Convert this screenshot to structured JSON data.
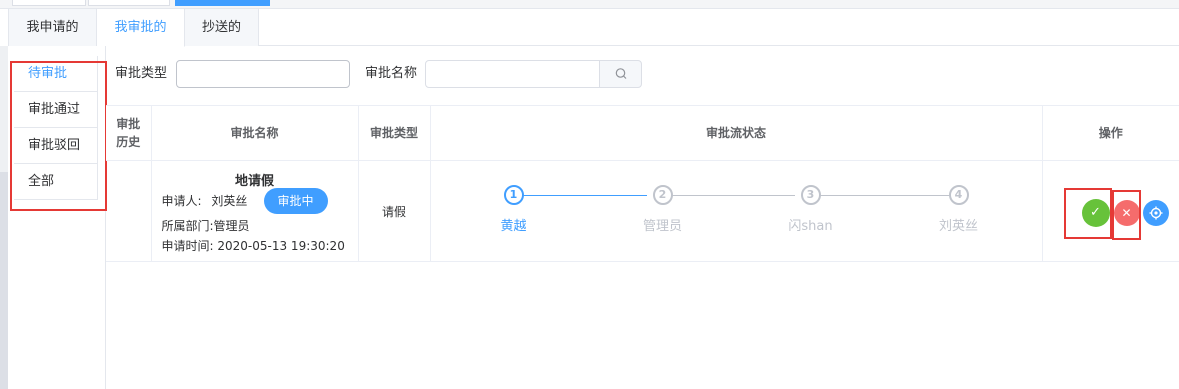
{
  "tabs": [
    {
      "label": "我申请的"
    },
    {
      "label": "我审批的"
    },
    {
      "label": "抄送的"
    }
  ],
  "side_menu": [
    {
      "label": "待审批"
    },
    {
      "label": "审批通过"
    },
    {
      "label": "审批驳回"
    },
    {
      "label": "全部"
    }
  ],
  "filters": {
    "type_label": "审批类型",
    "type_value": "",
    "name_label": "审批名称",
    "name_value": ""
  },
  "table": {
    "headers": {
      "history": "审批历史",
      "name": "审批名称",
      "type": "审批类型",
      "flow": "审批流状态",
      "ops": "操作"
    },
    "rows": [
      {
        "title": "地请假",
        "applicant_label": "申请人:",
        "applicant": "刘英丝",
        "dept_label": "所属部门:",
        "dept": "管理员",
        "time_label": "申请时间:",
        "time": "2020-05-13 19:30:20",
        "status": "审批中",
        "type": "请假",
        "steps": [
          {
            "num": "1",
            "name": "黄越"
          },
          {
            "num": "2",
            "name": "管理员"
          },
          {
            "num": "3",
            "name": "闪shan"
          },
          {
            "num": "4",
            "name": "刘英丝"
          }
        ]
      }
    ]
  },
  "icons": {
    "search": "search-icon",
    "approve": "check-icon",
    "reject": "close-icon",
    "more": "settings-icon"
  },
  "colors": {
    "primary": "#409eff",
    "success": "#67c23a",
    "danger": "#f56c6c",
    "highlight": "#e53935"
  }
}
